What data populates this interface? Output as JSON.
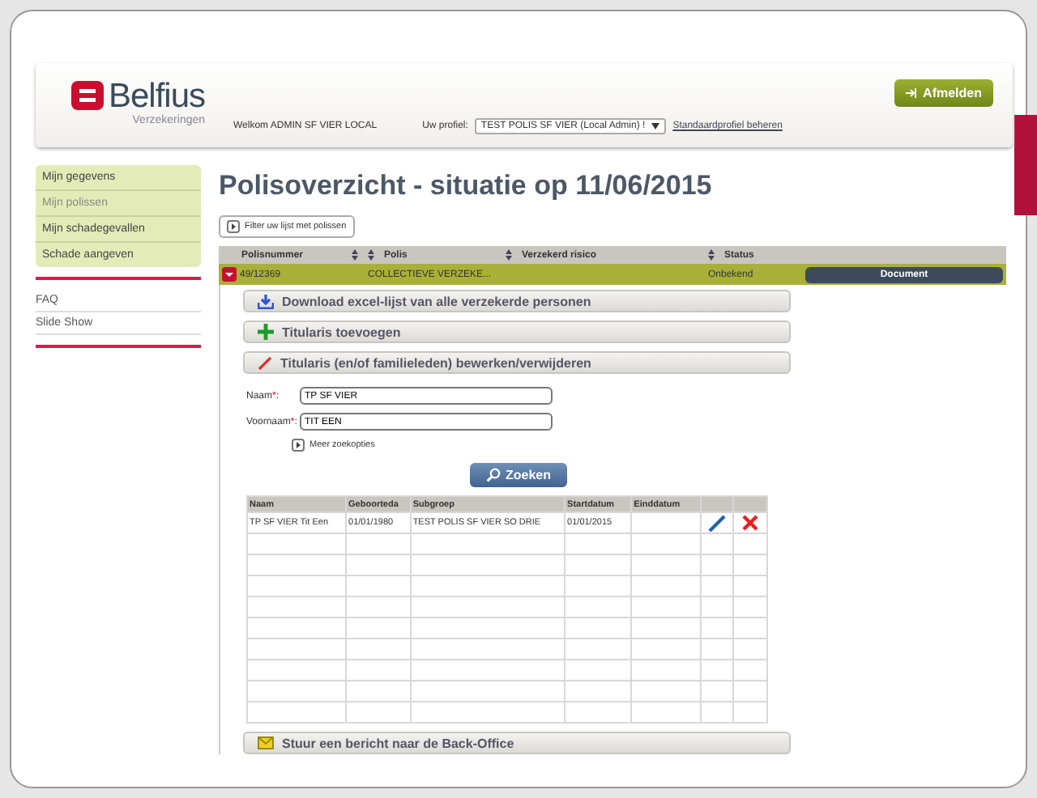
{
  "header": {
    "logo": {
      "brand": "Belfius",
      "sub": "Verzekeringen"
    },
    "welcome": "Welkom ADMIN SF VIER LOCAL",
    "profile_label": "Uw profiel:",
    "profile_value": "TEST POLIS SF VIER (Local Admin) !",
    "profile_link": "Standaardprofiel beheren",
    "logout_button": "Afmelden"
  },
  "sidebar": {
    "items": [
      {
        "label": "Mijn gegevens",
        "selected": false
      },
      {
        "label": "Mijn polissen",
        "selected": true
      },
      {
        "label": "Mijn schadegevallen",
        "selected": false
      },
      {
        "label": "Schade aangeven",
        "selected": false
      }
    ],
    "links": [
      "FAQ",
      "Slide Show"
    ]
  },
  "page_title": "Polisoverzicht - situatie op 11/06/2015",
  "filter_button": "Filter uw lijst met polissen",
  "policies": {
    "columns": [
      "Polisnummer",
      "Polis",
      "Verzekerd risico",
      "Status"
    ],
    "rows": [
      {
        "number": "49/12369",
        "policy": "COLLECTIEVE VERZEKE...",
        "status": "Onbekend",
        "button": "Document",
        "expanded": true
      }
    ]
  },
  "sections": [
    {
      "kind": "download",
      "label": "Download excel-lijst van alle verzekerde personen"
    },
    {
      "kind": "add",
      "label": "Titularis toevoegen"
    },
    {
      "kind": "edit",
      "label": "Titularis (en/of familieleden) bewerken/verwijderen"
    }
  ],
  "search_form": {
    "fields": [
      {
        "label": "Naam",
        "required_mark": "*",
        "separator": ":",
        "value": "TP SF VIER"
      },
      {
        "label": "Voornaam",
        "required_mark": "*",
        "separator": ":",
        "value": "TIT EEN"
      }
    ],
    "more_options": "Meer zoekopties",
    "search_button": "Zoeken"
  },
  "holders": {
    "columns": [
      "Naam",
      "Geboorteda",
      "Subgroep",
      "Startdatum",
      "Einddatum"
    ],
    "rows": [
      {
        "name": "TP SF VIER Tit Een",
        "birth": "01/01/1980",
        "subgroup": "TEST POLIS SF VIER SO DRIE",
        "start": "01/01/2015"
      }
    ]
  },
  "footer_section": {
    "kind": "message",
    "label": "Stuur een bericht naar de Back-Office"
  }
}
